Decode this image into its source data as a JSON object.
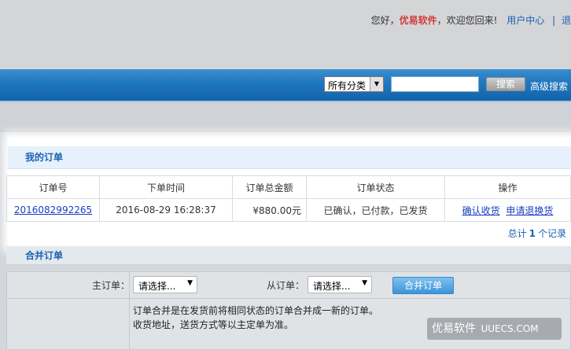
{
  "header": {
    "greeting_prefix": "您好，",
    "brand": "优易软件",
    "greeting_suffix": "，欢迎您回来!",
    "user_center": "用户中心",
    "sep": "|",
    "truncated_link": "退"
  },
  "search": {
    "category": "所有分类",
    "button": "搜索",
    "advanced": "高级搜索"
  },
  "orders": {
    "title": "我的订单",
    "columns": [
      "订单号",
      "下单时间",
      "订单总金额",
      "订单状态",
      "操作"
    ],
    "rows": [
      {
        "order_no": "2016082992265",
        "time": "2016-08-29 16:28:37",
        "amount": "¥880.00元",
        "status": "已确认，已付款，已发货",
        "action_confirm": "确认收货",
        "action_return": "申请退换货"
      }
    ],
    "total_prefix": "总计",
    "total_count": "1",
    "total_suffix": "个记录"
  },
  "merge": {
    "title": "合并订单",
    "main_label": "主订单：",
    "sub_label": "从订单：",
    "select_placeholder": "请选择...",
    "button": "合并订单",
    "note_line1": "订单合并是在发货前将相同状态的订单合并成一新的订单。",
    "note_line2": "收货地址，送货方式等以主定单为准。"
  },
  "watermark": {
    "cn": "优易软件",
    "en": "UUECS.COM"
  }
}
